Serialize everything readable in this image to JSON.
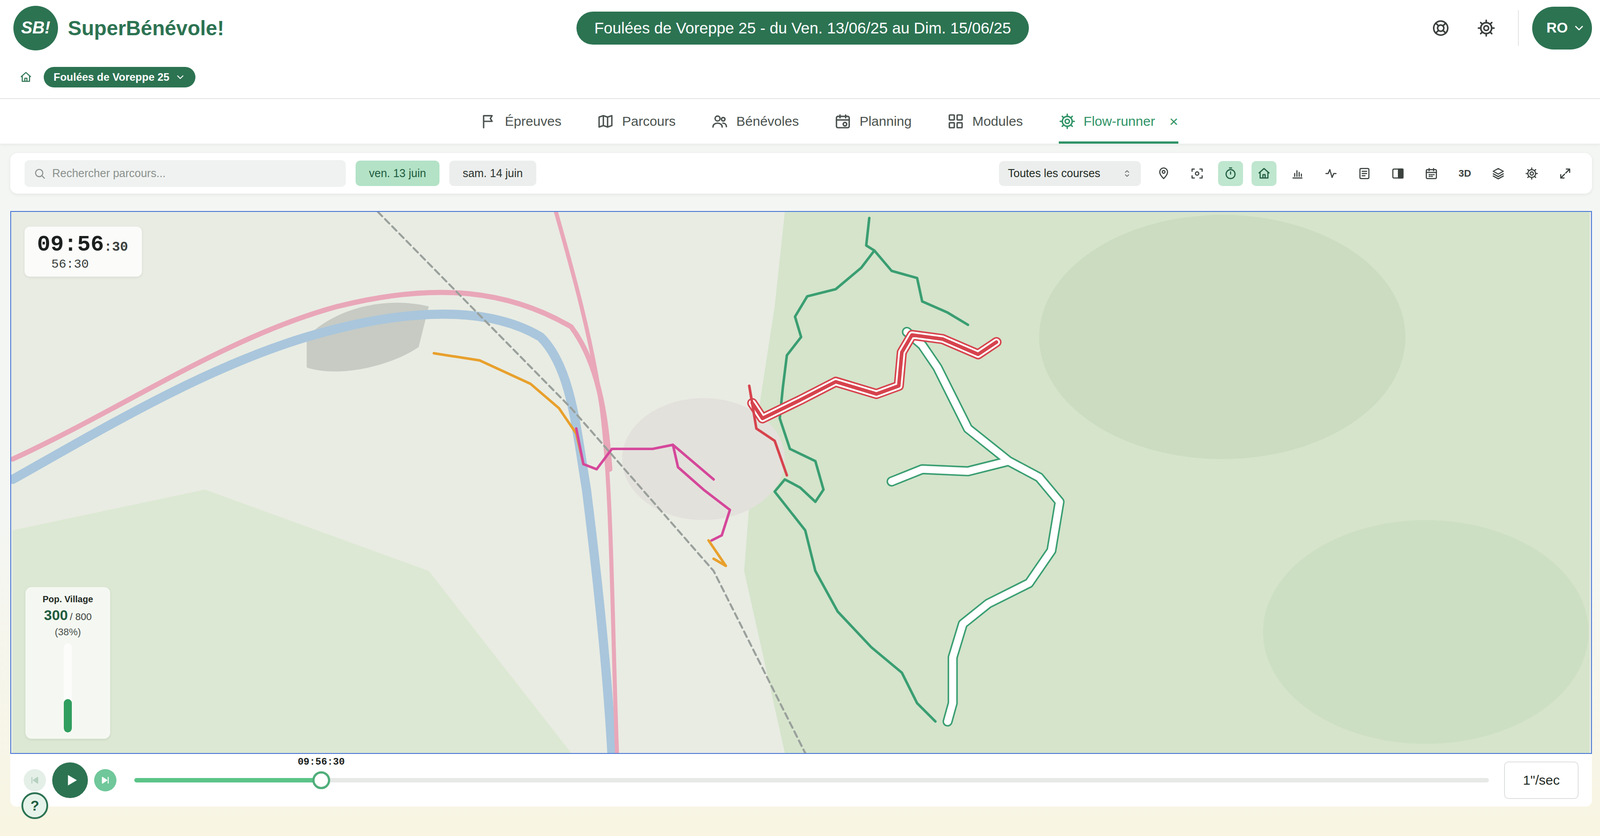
{
  "header": {
    "logo": "SB!",
    "brand": "SuperBénévole!",
    "event": "Foulées de Voreppe 25 - du Ven. 13/06/25 au Dim. 15/06/25",
    "avatar": "RO"
  },
  "breadcrumb": {
    "event": "Foulées de Voreppe 25"
  },
  "tabs": [
    {
      "label": "Épreuves",
      "kind": "flag",
      "selected": false,
      "close": ""
    },
    {
      "label": "Parcours",
      "kind": "map",
      "selected": false,
      "close": ""
    },
    {
      "label": "Bénévoles",
      "kind": "users",
      "selected": false,
      "close": ""
    },
    {
      "label": "Planning",
      "kind": "calendar",
      "selected": false,
      "close": ""
    },
    {
      "label": "Modules",
      "kind": "grid",
      "selected": false,
      "close": ""
    },
    {
      "label": "Flow-runner",
      "kind": "gear",
      "selected": true,
      "close": "×"
    }
  ],
  "toolbar": {
    "search_placeholder": "Rechercher parcours...",
    "days": [
      {
        "label": "ven. 13 juin",
        "selected": true
      },
      {
        "label": "sam. 14 juin",
        "selected": false
      }
    ],
    "race_filter": "Toutes les courses",
    "tools": [
      {
        "kind": "pin",
        "label": "",
        "selected": false
      },
      {
        "kind": "focus",
        "label": "",
        "selected": false
      },
      {
        "kind": "timer",
        "label": "",
        "selected": true
      },
      {
        "kind": "home",
        "label": "",
        "selected": true
      },
      {
        "kind": "bars",
        "label": "",
        "selected": false
      },
      {
        "kind": "pulse",
        "label": "",
        "selected": false
      },
      {
        "kind": "list",
        "label": "",
        "selected": false
      },
      {
        "kind": "panel",
        "label": "",
        "selected": false
      },
      {
        "kind": "calendar",
        "label": "",
        "selected": false
      },
      {
        "kind": "text",
        "label": "3D",
        "selected": false
      },
      {
        "kind": "layers",
        "label": "",
        "selected": false
      },
      {
        "kind": "gear",
        "label": "",
        "selected": false
      },
      {
        "kind": "expand",
        "label": "",
        "selected": false
      }
    ]
  },
  "map": {
    "clock": {
      "time": "09:56",
      "seconds": ":30",
      "elapsed": "56:30"
    },
    "routes": [
      {
        "color": "#3a9e72",
        "highlighted": false
      },
      {
        "color": "#3a9e72",
        "highlighted": true
      },
      {
        "color": "#d6434d",
        "highlighted": true
      },
      {
        "color": "#d6434d",
        "highlighted": false
      },
      {
        "color": "#e8a02c",
        "highlighted": false
      },
      {
        "color": "#d5479a",
        "highlighted": false
      }
    ],
    "village": {
      "title": "Pop. Village",
      "count": "300",
      "capacity": "/ 800",
      "percent": "(38%)",
      "level": 0.375
    }
  },
  "player": {
    "time": "09:56:30",
    "level": 0.138,
    "speed": "1\"/sec",
    "buttons": [
      {
        "kind": "previous",
        "disabled": true
      },
      {
        "kind": "play",
        "disabled": false
      },
      {
        "kind": "next",
        "disabled": false
      }
    ]
  },
  "help": "?"
}
